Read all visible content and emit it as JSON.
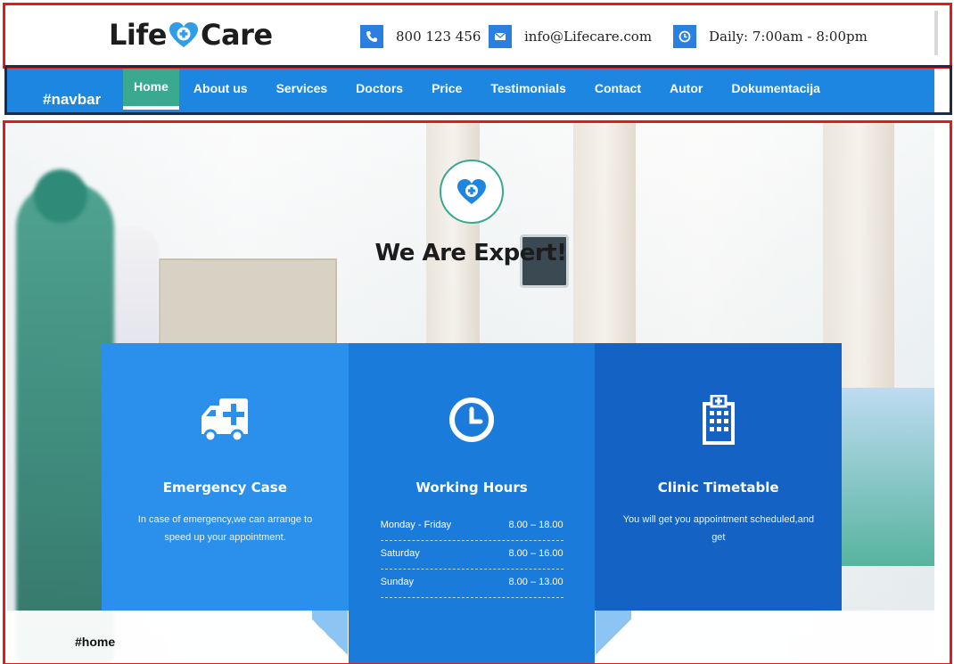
{
  "brand": {
    "name_part1": "Life",
    "name_part2": "Care"
  },
  "contact": {
    "phone": "800 123 456",
    "email": "info@Lifecare.com",
    "hours": "Daily: 7:00am - 8:00pm"
  },
  "navbar": {
    "tag": "#navbar",
    "items": [
      {
        "label": "Home",
        "active": true
      },
      {
        "label": "About us"
      },
      {
        "label": "Services"
      },
      {
        "label": "Doctors"
      },
      {
        "label": "Price"
      },
      {
        "label": "Testimonials"
      },
      {
        "label": "Contact"
      },
      {
        "label": "Autor"
      },
      {
        "label": "Dokumentacija"
      }
    ]
  },
  "hero": {
    "title": "We Are Expert!",
    "tag": "#home"
  },
  "cards": {
    "emergency": {
      "title": "Emergency Case",
      "text": "In case of emergency,we can arrange to speed up your appointment."
    },
    "working": {
      "title": "Working Hours",
      "rows": [
        {
          "day": "Monday - Friday",
          "time": "8.00 – 18.00"
        },
        {
          "day": "Saturday",
          "time": "8.00 – 16.00"
        },
        {
          "day": "Sunday",
          "time": "8.00 – 13.00"
        }
      ]
    },
    "timetable": {
      "title": "Clinic Timetable",
      "text": "You will get you appointment scheduled,and get"
    }
  },
  "colors": {
    "accent_blue": "#1d86e0",
    "accent_green": "#3aa990",
    "outline_red": "#e11b1b"
  },
  "icons": {
    "phone": "phone-icon",
    "email": "envelope-icon",
    "hours": "clock-icon",
    "logo": "heart-plus-icon",
    "emergency": "ambulance-icon",
    "working": "clock-icon",
    "timetable": "hospital-building-icon"
  }
}
